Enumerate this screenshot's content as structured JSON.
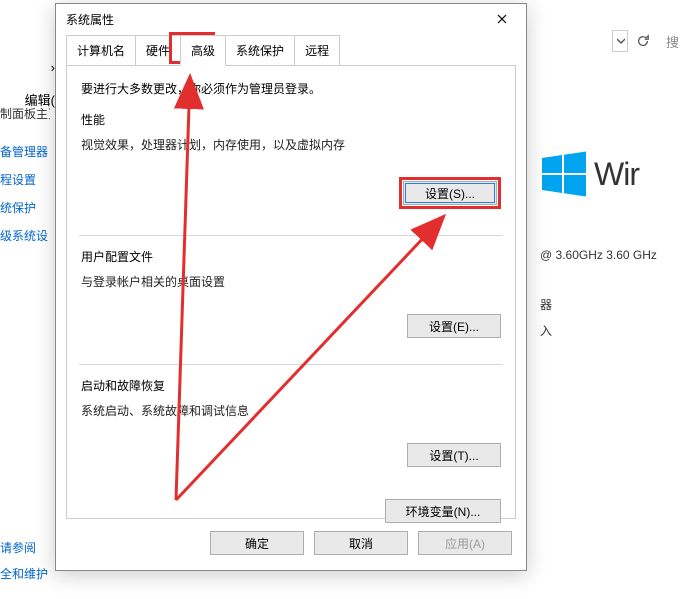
{
  "dialog": {
    "title": "系统属性",
    "tabs": [
      "计算机名",
      "硬件",
      "高级",
      "系统保护",
      "远程"
    ],
    "active_tab_index": 2,
    "intro": "要进行大多数更改，你必须作为管理员登录。",
    "groups": {
      "perf": {
        "title": "性能",
        "desc": "视觉效果，处理器计划，内存使用，以及虚拟内存",
        "btn": "设置(S)..."
      },
      "profile": {
        "title": "用户配置文件",
        "desc": "与登录帐户相关的桌面设置",
        "btn": "设置(E)..."
      },
      "startup": {
        "title": "启动和故障恢复",
        "desc": "系统启动、系统故障和调试信息",
        "btn": "设置(T)..."
      }
    },
    "env_btn": "环境变量(N)...",
    "footer": {
      "ok": "确定",
      "cancel": "取消",
      "apply": "应用(A)"
    }
  },
  "bg": {
    "breadcrumb_arrow": "›",
    "edit_menu": "编辑(",
    "search_placeholder": "搜",
    "sidebar_head": "制面板主页",
    "sidebar": [
      "备管理器",
      "程设置",
      "统保护",
      "级系统设"
    ],
    "footer": [
      "请参阅",
      "全和维护"
    ],
    "win_text": "Wir",
    "cpu": "@ 3.60GHz   3.60 GHz",
    "small": [
      "器",
      "入"
    ]
  }
}
